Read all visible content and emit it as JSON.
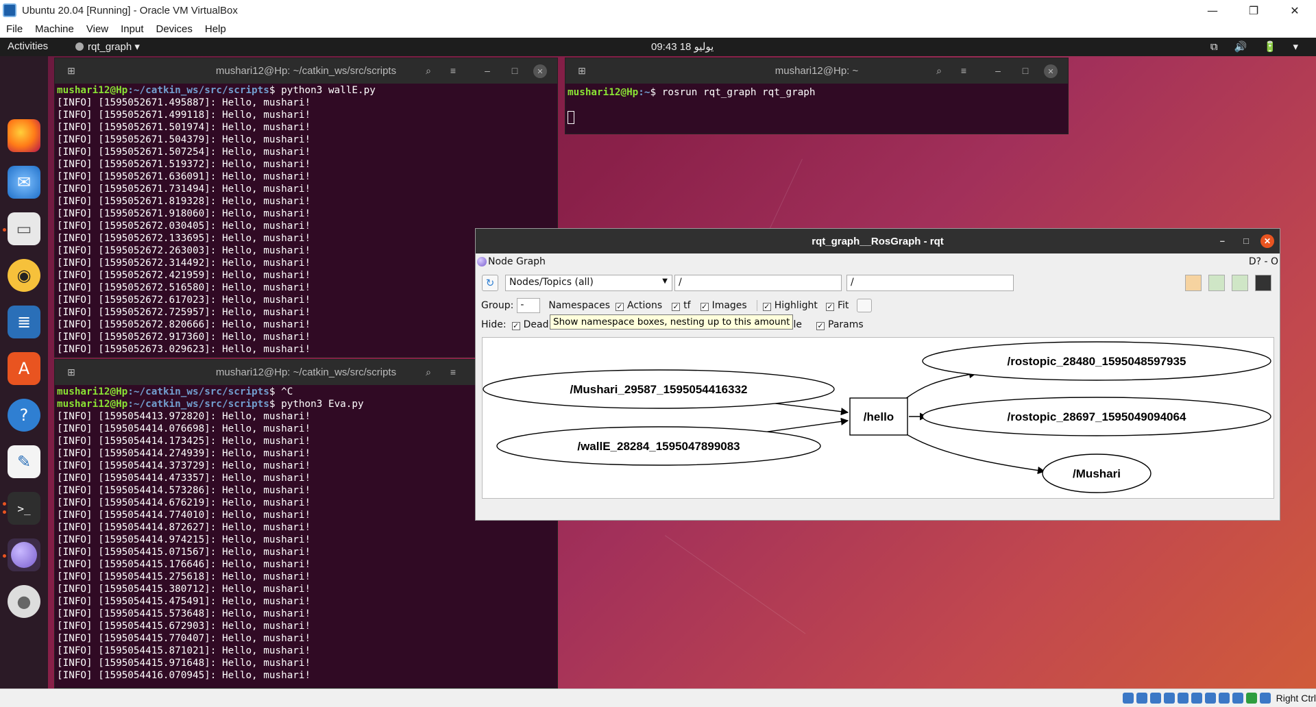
{
  "host": {
    "title": "Ubuntu 20.04 [Running] - Oracle VM VirtualBox",
    "menu": [
      "File",
      "Machine",
      "View",
      "Input",
      "Devices",
      "Help"
    ],
    "controls": {
      "minimize": "—",
      "maximize": "❐",
      "close": "✕"
    },
    "status_key": "Right Ctrl"
  },
  "topbar": {
    "activities": "Activities",
    "app": "rqt_graph ▾",
    "clock": "09:43  18 يوليو",
    "tray": "⧉ 🔊 🔋 ▾"
  },
  "dock": {
    "items": [
      "firefox-icon",
      "thunderbird-icon",
      "files-icon",
      "rhythmbox-icon",
      "libreoffice-writer-icon",
      "ubuntu-software-icon",
      "help-icon",
      "text-editor-icon",
      "terminal-icon",
      "rqt-icon",
      "dvd-icon"
    ],
    "show_apps": "show-applications-icon"
  },
  "term1": {
    "title": "mushari12@Hp: ~/catkin_ws/src/scripts",
    "prompt_user": "mushari12@Hp",
    "prompt_path": ":~/catkin_ws/src/scripts",
    "command": "$ python3 wallE.py",
    "lines": [
      "[INFO] [1595052671.495887]: Hello, mushari!",
      "[INFO] [1595052671.499118]: Hello, mushari!",
      "[INFO] [1595052671.501974]: Hello, mushari!",
      "[INFO] [1595052671.504379]: Hello, mushari!",
      "[INFO] [1595052671.507254]: Hello, mushari!",
      "[INFO] [1595052671.519372]: Hello, mushari!",
      "[INFO] [1595052671.636091]: Hello, mushari!",
      "[INFO] [1595052671.731494]: Hello, mushari!",
      "[INFO] [1595052671.819328]: Hello, mushari!",
      "[INFO] [1595052671.918060]: Hello, mushari!",
      "[INFO] [1595052672.030405]: Hello, mushari!",
      "[INFO] [1595052672.133695]: Hello, mushari!",
      "[INFO] [1595052672.263003]: Hello, mushari!",
      "[INFO] [1595052672.314492]: Hello, mushari!",
      "[INFO] [1595052672.421959]: Hello, mushari!",
      "[INFO] [1595052672.516580]: Hello, mushari!",
      "[INFO] [1595052672.617023]: Hello, mushari!",
      "[INFO] [1595052672.725957]: Hello, mushari!",
      "[INFO] [1595052672.820666]: Hello, mushari!",
      "[INFO] [1595052672.917360]: Hello, mushari!",
      "[INFO] [1595052673.029623]: Hello, mushari!"
    ]
  },
  "term2": {
    "title": "mushari12@Hp: ~",
    "prompt_user": "mushari12@Hp",
    "prompt_path": ":~",
    "command": "$ rosrun rqt_graph rqt_graph"
  },
  "term3": {
    "title": "mushari12@Hp: ~/catkin_ws/src/scripts",
    "prompt_user": "mushari12@Hp",
    "prompt_path": ":~/catkin_ws/src/scripts",
    "command1": "$ ^C",
    "command2": "$ python3 Eva.py",
    "lines": [
      "[INFO] [1595054413.972820]: Hello, mushari!",
      "[INFO] [1595054414.076698]: Hello, mushari!",
      "[INFO] [1595054414.173425]: Hello, mushari!",
      "[INFO] [1595054414.274939]: Hello, mushari!",
      "[INFO] [1595054414.373729]: Hello, mushari!",
      "[INFO] [1595054414.473357]: Hello, mushari!",
      "[INFO] [1595054414.573286]: Hello, mushari!",
      "[INFO] [1595054414.676219]: Hello, mushari!",
      "[INFO] [1595054414.774010]: Hello, mushari!",
      "[INFO] [1595054414.872627]: Hello, mushari!",
      "[INFO] [1595054414.974215]: Hello, mushari!",
      "[INFO] [1595054415.071567]: Hello, mushari!",
      "[INFO] [1595054415.176646]: Hello, mushari!",
      "[INFO] [1595054415.275618]: Hello, mushari!",
      "[INFO] [1595054415.380712]: Hello, mushari!",
      "[INFO] [1595054415.475491]: Hello, mushari!",
      "[INFO] [1595054415.573648]: Hello, mushari!",
      "[INFO] [1595054415.672903]: Hello, mushari!",
      "[INFO] [1595054415.770407]: Hello, mushari!",
      "[INFO] [1595054415.871021]: Hello, mushari!",
      "[INFO] [1595054415.971648]: Hello, mushari!",
      "[INFO] [1595054416.070945]: Hello, mushari!"
    ]
  },
  "rqt": {
    "title": "rqt_graph__RosGraph - rqt",
    "plugin": "Node Graph",
    "dock_btns": "D? - O",
    "mode": "Nodes/Topics (all)",
    "filter1": "/",
    "filter2": "/",
    "group_label": "Group:",
    "group_value": "-",
    "namespaces": "Namespaces",
    "actions": "Actions",
    "tf": "tf",
    "images": "Images",
    "highlight": "Highlight",
    "fit": "Fit",
    "hide_label": "Hide:",
    "dead": "Dead",
    "able": "able",
    "params": "Params",
    "tooltip": "Show namespace boxes, nesting up to this amount",
    "nodes": {
      "mushari_node": "/Mushari_29587_1595054416332",
      "walle": "/wallE_28284_1595047899083",
      "hello": "/hello",
      "rostopic1": "/rostopic_28480_1595048597935",
      "rostopic2": "/rostopic_28697_1595049094064",
      "mushari": "/Mushari"
    }
  }
}
